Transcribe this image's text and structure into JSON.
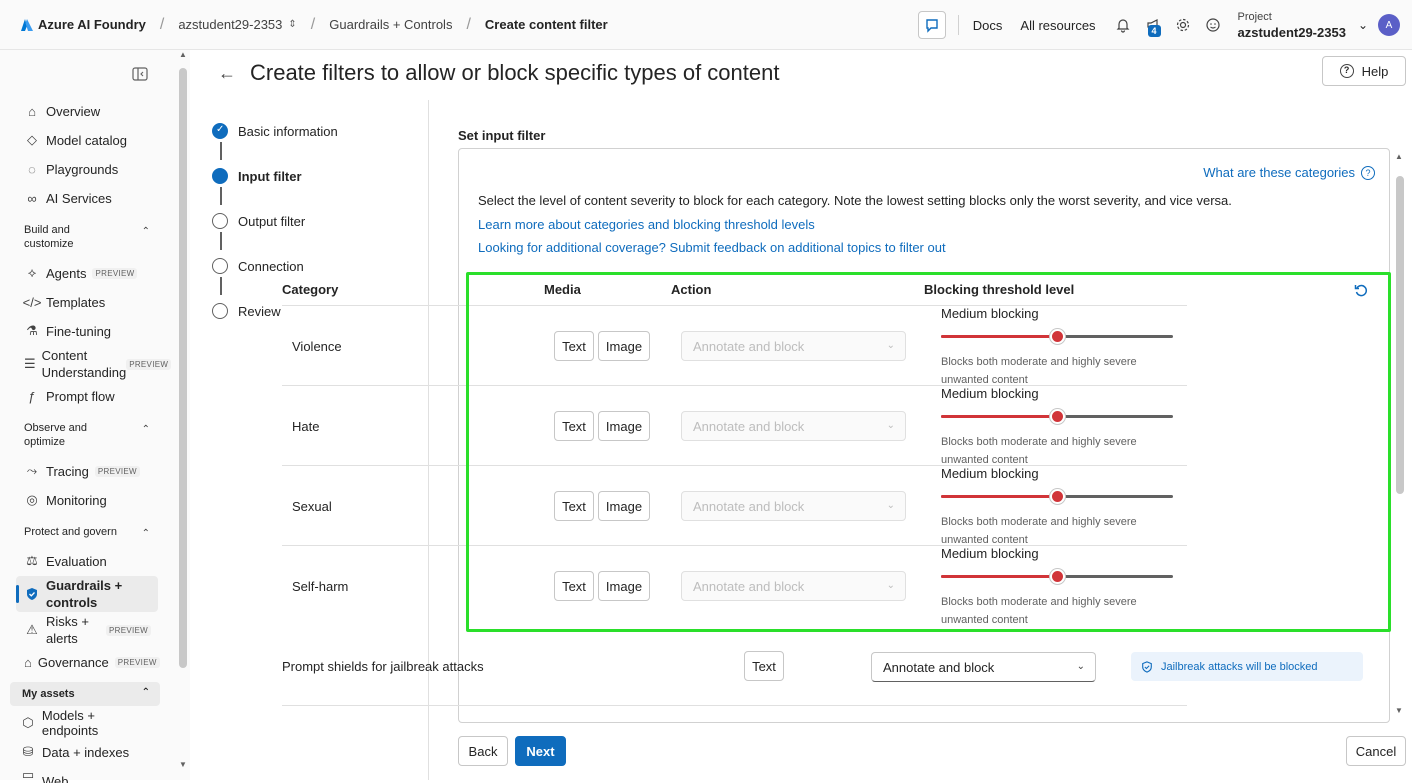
{
  "topbar": {
    "brand": "Azure AI Foundry",
    "breadcrumbs": [
      "azstudent29-2353",
      "Guardrails + Controls",
      "Create content filter"
    ],
    "docs": "Docs",
    "all_resources": "All resources",
    "notification_count": "4",
    "project_label": "Project",
    "project_name": "azstudent29-2353",
    "avatar_initial": "A"
  },
  "sidebar": {
    "items_top": [
      "Overview",
      "Model catalog",
      "Playgrounds",
      "AI Services"
    ],
    "group_build": "Build and customize",
    "items_build": [
      {
        "label": "Agents",
        "badge": "PREVIEW"
      },
      {
        "label": "Templates",
        "badge": ""
      },
      {
        "label": "Fine-tuning",
        "badge": ""
      },
      {
        "label": "Content Understanding",
        "badge": "PREVIEW"
      },
      {
        "label": "Prompt flow",
        "badge": ""
      }
    ],
    "group_observe": "Observe and optimize",
    "items_observe": [
      {
        "label": "Tracing",
        "badge": "PREVIEW"
      },
      {
        "label": "Monitoring",
        "badge": ""
      }
    ],
    "group_protect": "Protect and govern",
    "items_protect": [
      {
        "label": "Evaluation",
        "badge": ""
      },
      {
        "label": "Guardrails + controls",
        "badge": ""
      },
      {
        "label": "Risks + alerts",
        "badge": "PREVIEW"
      },
      {
        "label": "Governance",
        "badge": "PREVIEW"
      }
    ],
    "group_assets": "My assets",
    "items_assets": [
      "Models + endpoints",
      "Data + indexes",
      "Web"
    ]
  },
  "page": {
    "title": "Create filters to allow or block specific types of content",
    "help": "Help"
  },
  "steps": [
    {
      "label": "Basic information",
      "state": "done"
    },
    {
      "label": "Input filter",
      "state": "current"
    },
    {
      "label": "Output filter",
      "state": "todo"
    },
    {
      "label": "Connection",
      "state": "todo"
    },
    {
      "label": "Review",
      "state": "todo"
    }
  ],
  "filter": {
    "section_title": "Set input filter",
    "what_link": "What are these categories",
    "description": "Select the level of content severity to block for each category. Note the lowest setting blocks only the worst severity, and vice versa.",
    "learn_link": "Learn more about categories and blocking threshold levels",
    "coverage_link": "Looking for additional coverage? Submit feedback on additional topics to filter out",
    "columns": {
      "category": "Category",
      "media": "Media",
      "action": "Action",
      "threshold": "Blocking threshold level"
    },
    "media_text": "Text",
    "media_image": "Image",
    "rows": [
      {
        "category": "Violence",
        "action": "Annotate and block",
        "level": "Medium blocking",
        "level_value": 0.5,
        "level_desc": "Blocks both moderate and highly severe unwanted content"
      },
      {
        "category": "Hate",
        "action": "Annotate and block",
        "level": "Medium blocking",
        "level_value": 0.5,
        "level_desc": "Blocks both moderate and highly severe unwanted content"
      },
      {
        "category": "Sexual",
        "action": "Annotate and block",
        "level": "Medium blocking",
        "level_value": 0.5,
        "level_desc": "Blocks both moderate and highly severe unwanted content"
      },
      {
        "category": "Self-harm",
        "action": "Annotate and block",
        "level": "Medium blocking",
        "level_value": 0.5,
        "level_desc": "Blocks both moderate and highly severe unwanted content"
      }
    ],
    "shield": {
      "category": "Prompt shields for jailbreak attacks",
      "media": "Text",
      "action": "Annotate and block",
      "info": "Jailbreak attacks will be blocked"
    }
  },
  "footer": {
    "back": "Back",
    "next": "Next",
    "cancel": "Cancel"
  },
  "colors": {
    "accent": "#0f6cbd",
    "slider_red": "#d13438",
    "highlight": "#2adf2a"
  }
}
